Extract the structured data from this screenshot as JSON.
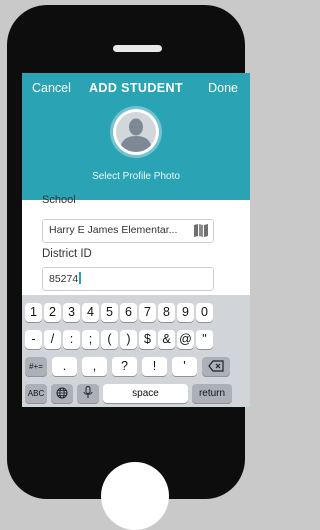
{
  "header": {
    "cancel_label": "Cancel",
    "title": "ADD STUDENT",
    "done_label": "Done",
    "select_photo_label": "Select Profile Photo"
  },
  "form": {
    "school_label": "School",
    "school_value": "Harry E James Elementar...",
    "district_label": "District ID",
    "district_value": "85274"
  },
  "keyboard": {
    "row1": [
      "1",
      "2",
      "3",
      "4",
      "5",
      "6",
      "7",
      "8",
      "9",
      "0"
    ],
    "row2": [
      "-",
      "/",
      ":",
      ";",
      "(",
      ")",
      "$",
      "&",
      "@",
      "\""
    ],
    "row3": {
      "toggle_label": "#+=",
      "keys": [
        ".",
        ",",
        "?",
        "!",
        "'"
      ]
    },
    "row4": {
      "abc_label": "ABC",
      "space_label": "space",
      "return_label": "return"
    }
  },
  "colors": {
    "accent": "#2aa4b5",
    "keyboard_bg": "#d1d4d9"
  },
  "icons": [
    "person-avatar-icon",
    "map-icon",
    "backspace-icon",
    "globe-icon",
    "microphone-icon"
  ]
}
